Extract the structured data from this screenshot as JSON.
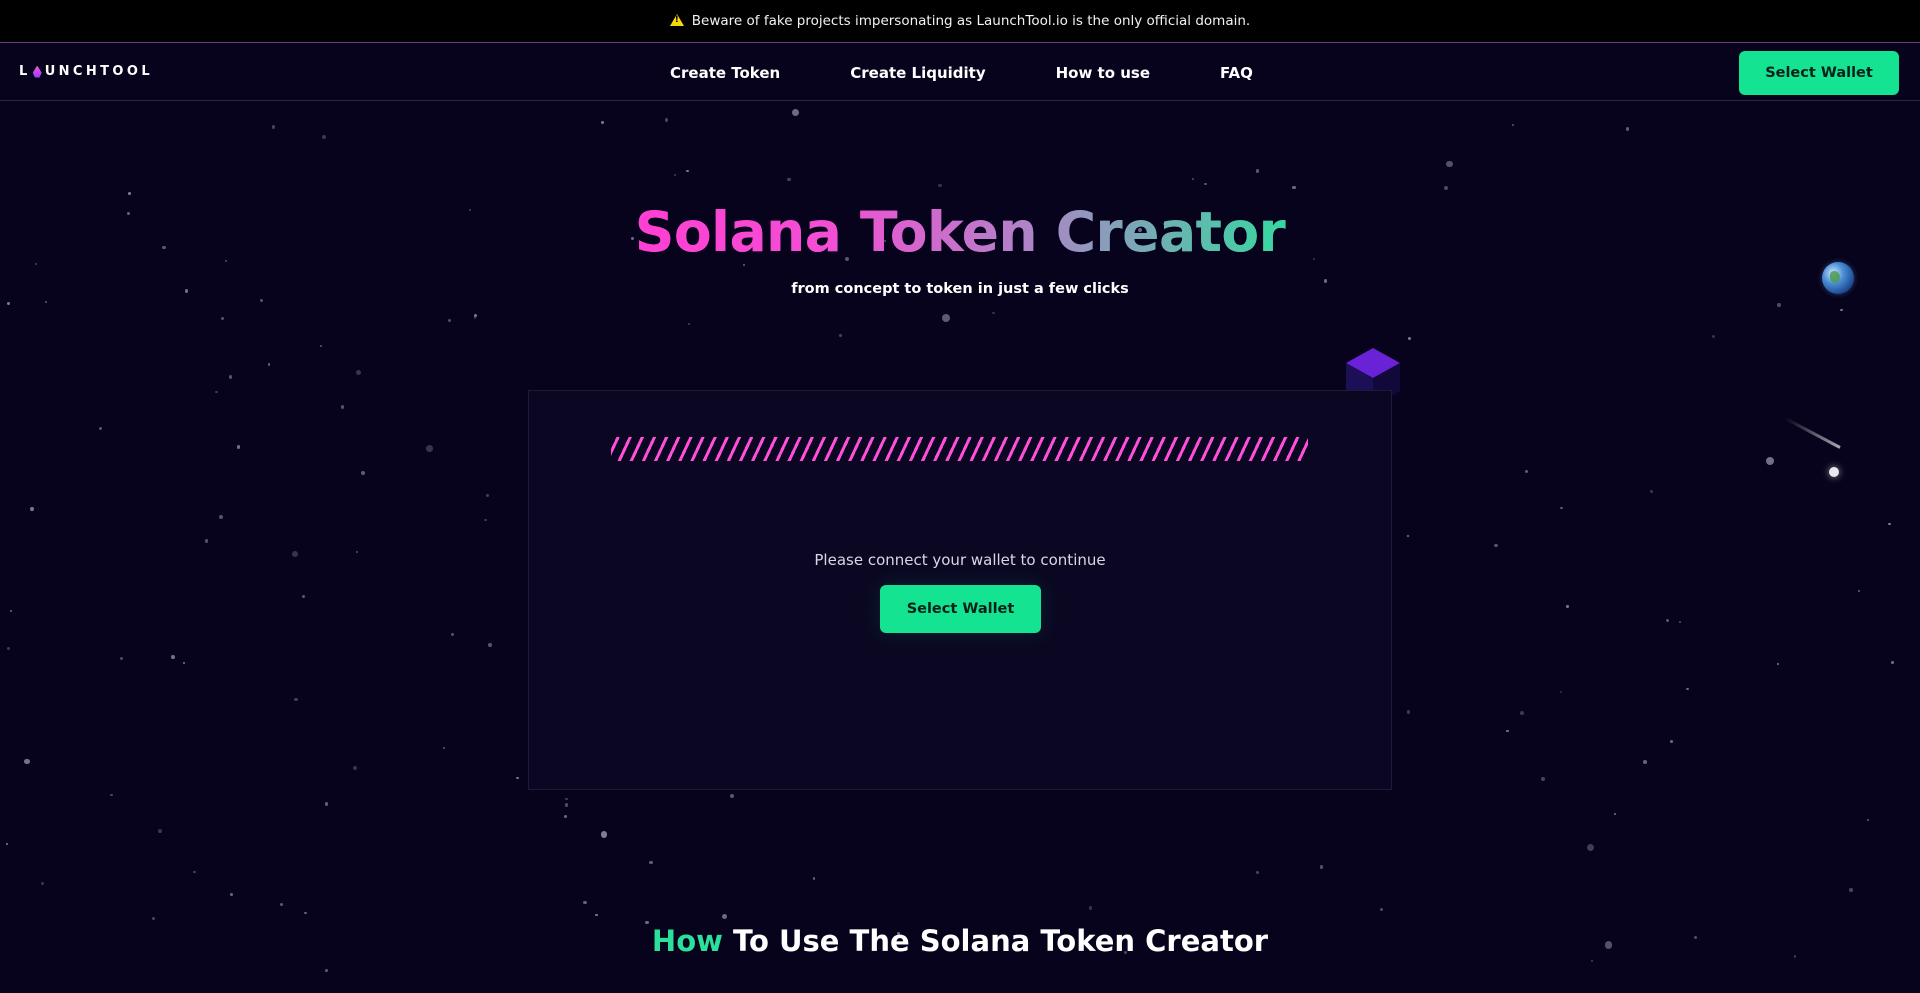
{
  "announcement": {
    "text": "Beware of fake projects impersonating as LaunchTool.io is the only official domain."
  },
  "logo": {
    "text_before": "L",
    "text_after": "UNCHTOOL"
  },
  "nav": {
    "links": [
      "Create Token",
      "Create Liquidity",
      "How to use",
      "FAQ"
    ],
    "wallet_button": "Select Wallet"
  },
  "hero": {
    "title": "Solana Token Creator",
    "subtitle": "from concept to token in just a few clicks"
  },
  "card": {
    "connect_text": "Please connect your wallet to continue",
    "wallet_button": "Select Wallet"
  },
  "how_section": {
    "accent": "How",
    "rest": "To Use The Solana Token Creator"
  },
  "colors": {
    "background": "#07031c",
    "accent_green": "#14e391",
    "accent_pink": "#ff3fd2",
    "card": "#0b0722"
  }
}
